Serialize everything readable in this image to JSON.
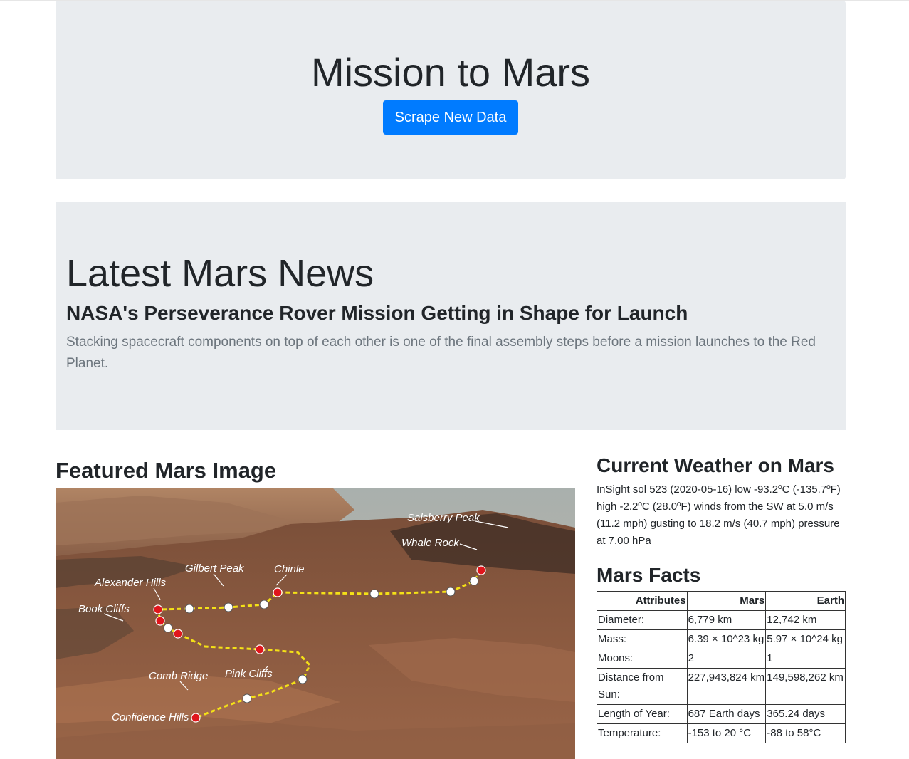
{
  "header": {
    "title": "Mission to Mars",
    "scrape_button": "Scrape New Data"
  },
  "news": {
    "heading": "Latest Mars News",
    "title": "NASA's Perseverance Rover Mission Getting in Shape for Launch",
    "paragraph": "Stacking spacecraft components on top of each other is one of the final assembly steps before a mission launches to the Red Planet."
  },
  "featured": {
    "heading": "Featured Mars Image",
    "labels": {
      "salsberry": "Salsberry Peak",
      "whale": "Whale Rock",
      "gilbert": "Gilbert Peak",
      "chinle": "Chinle",
      "alexander": "Alexander Hills",
      "book": "Book Cliffs",
      "comb": "Comb Ridge",
      "pink": "Pink Cliffs",
      "confidence": "Confidence Hills"
    }
  },
  "weather": {
    "heading": "Current Weather on Mars",
    "text": "InSight sol 523 (2020-05-16) low -93.2ºC (-135.7ºF) high -2.2ºC (28.0ºF) winds from the SW at 5.0 m/s (11.2 mph) gusting to 18.2 m/s (40.7 mph) pressure at 7.00 hPa"
  },
  "facts": {
    "heading": "Mars Facts",
    "headers": [
      "Attributes",
      "Mars",
      "Earth"
    ],
    "rows": [
      [
        "Diameter:",
        "6,779 km",
        "12,742 km"
      ],
      [
        "Mass:",
        "6.39 × 10^23 kg",
        "5.97 × 10^24 kg"
      ],
      [
        "Moons:",
        "2",
        "1"
      ],
      [
        "Distance from Sun:",
        "227,943,824 km",
        "149,598,262 km"
      ],
      [
        "Length of Year:",
        "687 Earth days",
        "365.24 days"
      ],
      [
        "Temperature:",
        "-153 to 20 °C",
        "-88 to 58°C"
      ]
    ]
  },
  "colors": {
    "accent": "#007bff",
    "jumbotron": "#e9ecef"
  }
}
